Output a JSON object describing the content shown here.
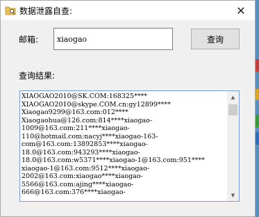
{
  "window": {
    "title": "数据泄露自查:",
    "icon": "folder-search-icon",
    "close_glyph": "✕"
  },
  "form": {
    "email_label": "邮箱:",
    "email_value": "xiaogao",
    "query_button": "查询",
    "results_label": "查询结果:"
  },
  "results": {
    "lines": [
      "XIAOGAO2010@SK.COM:168325****",
      "XIAOGAO2010@skype.COM.cn:gy12899****",
      "Xiaogao9299@163.com:012****",
      "Xiaogaohua@126.com:814****xiaogao-",
      "1009@163.com:211****xiaogao-",
      "110@hotmail.com:nacyj****xiaogao-163-",
      "com@163.com:13892853****xiaogao-",
      "18.0@163.com:943293****xiaogao-",
      "18.0@163.com:w5371****xiaogao-1@163.com:951****",
      "xiaogao-1@163.com:9512****xiaogao-",
      "2002@163.com:xiaogao****xiaogao-",
      "5566@163.com:ajing****xiaogao-",
      "666@163.com:376****xiaogao-"
    ],
    "scroll_up_glyph": "▲",
    "scroll_down_glyph": "▼"
  },
  "colors": {
    "window_bg": "#f0f0f0",
    "titlebar_bg": "#ffffff",
    "results_border": "#7a9cd3",
    "desktop_bg": "#5a8fc0"
  }
}
